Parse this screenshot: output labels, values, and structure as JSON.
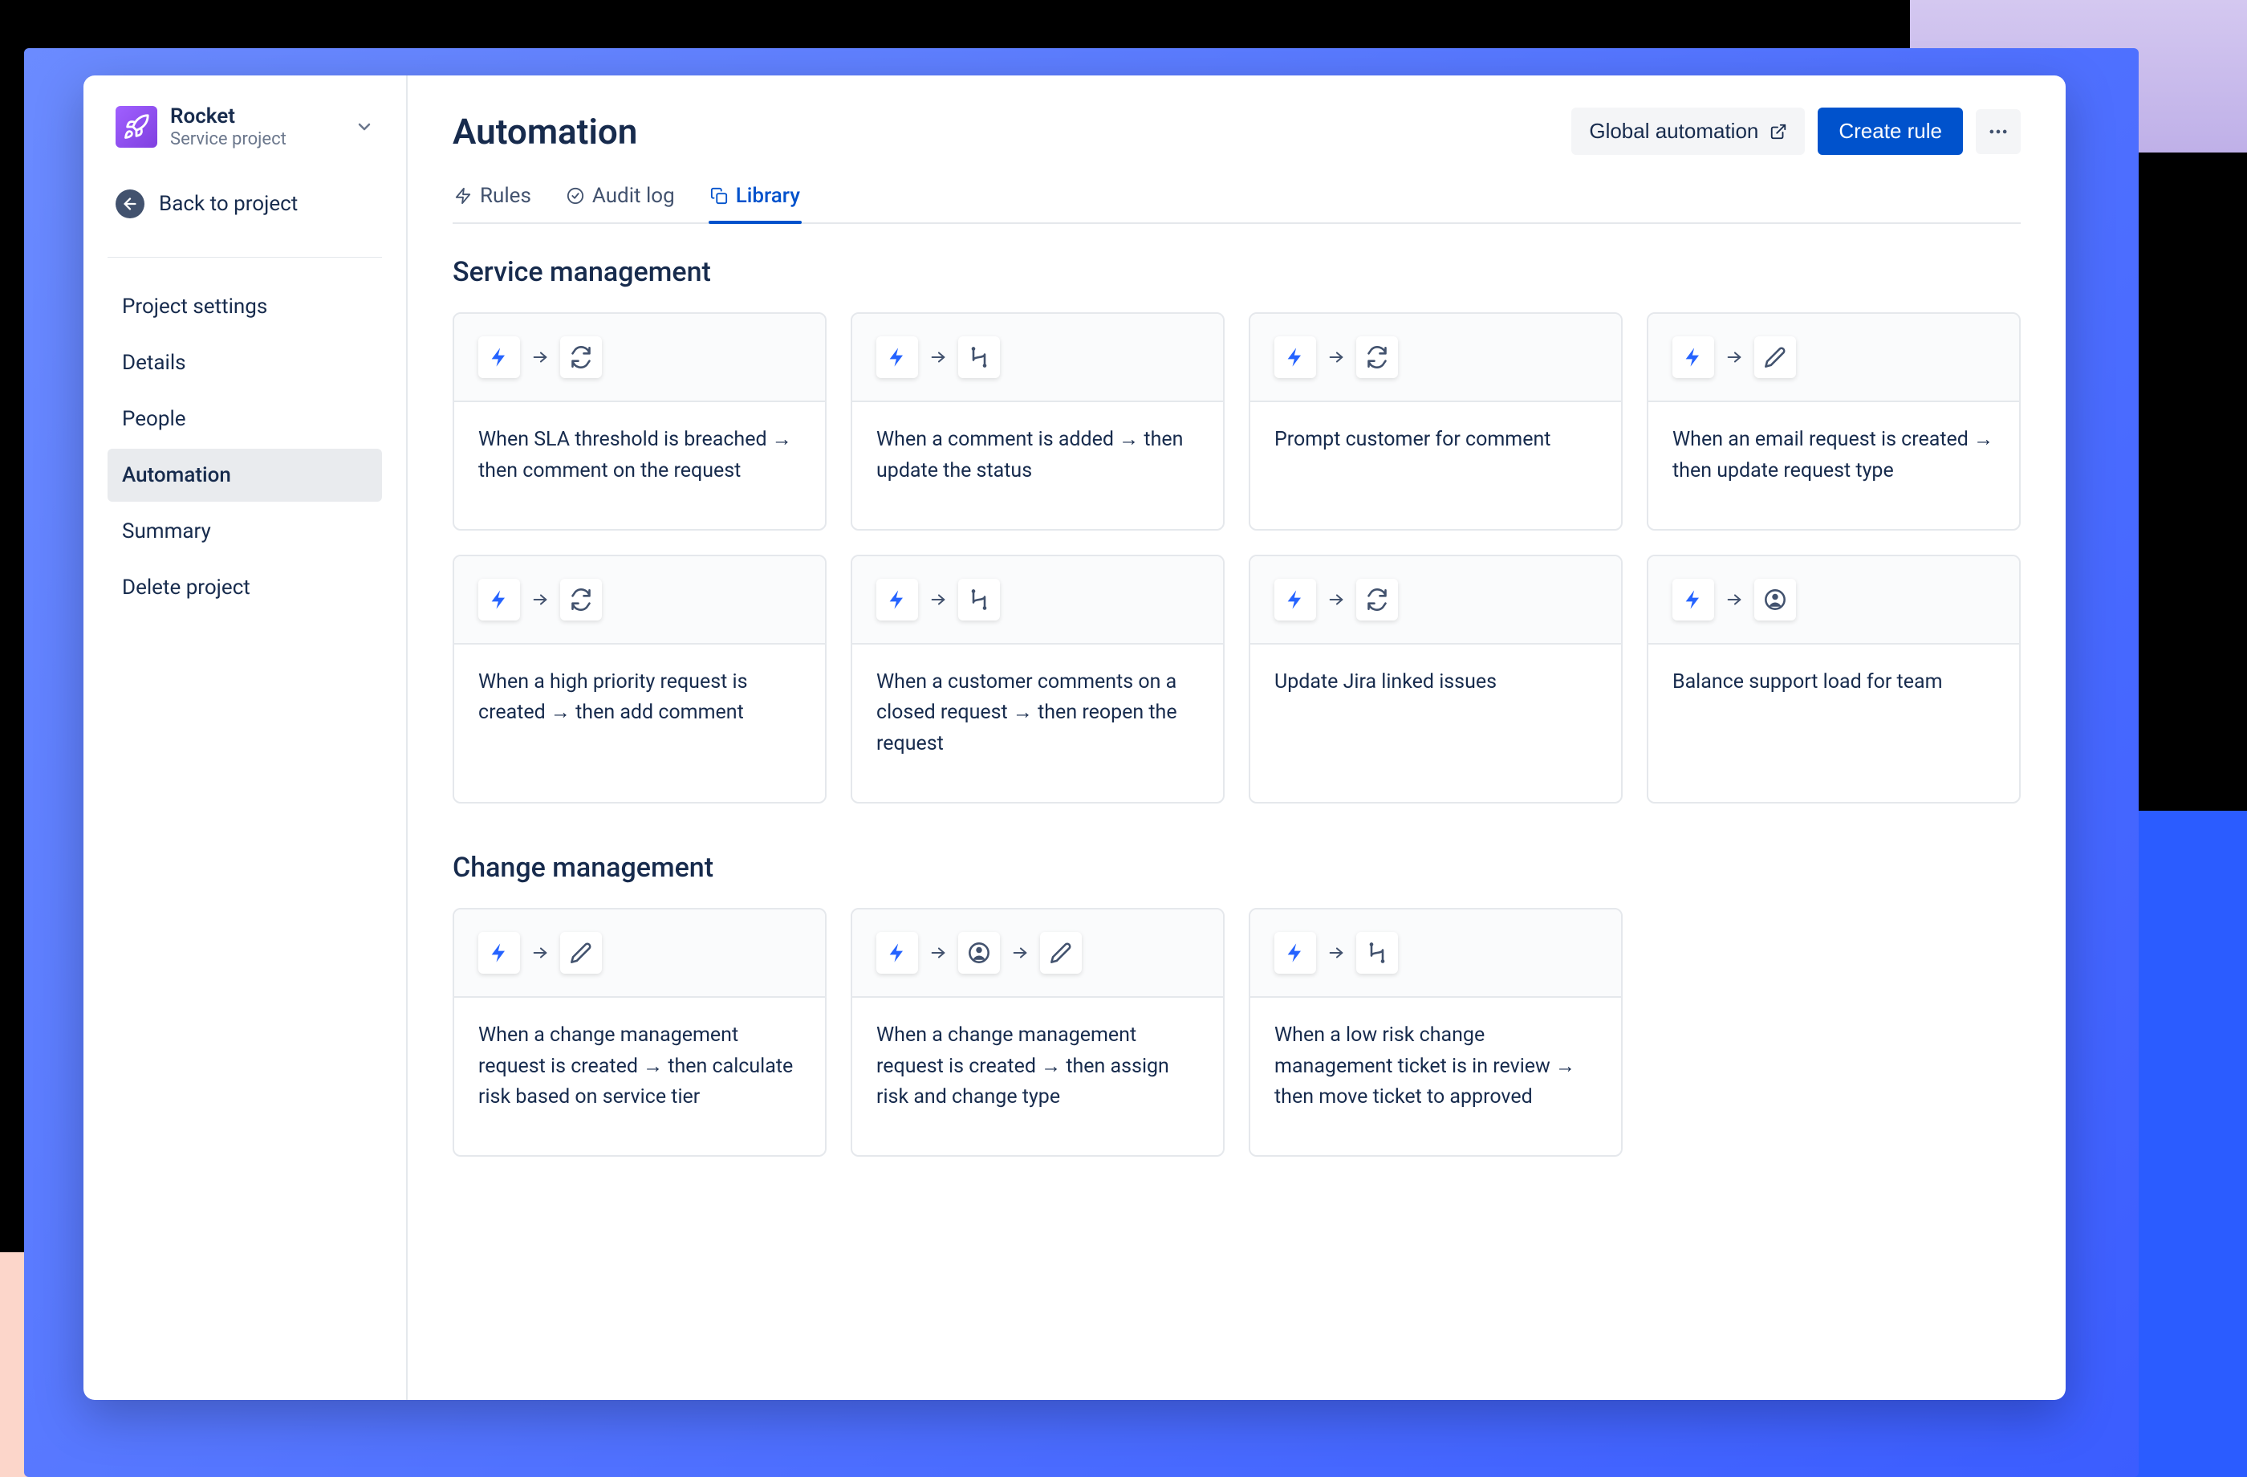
{
  "project": {
    "name": "Rocket",
    "subtitle": "Service project"
  },
  "back_link_label": "Back to project",
  "sidebar_items": [
    {
      "label": "Project settings"
    },
    {
      "label": "Details"
    },
    {
      "label": "People"
    },
    {
      "label": "Automation"
    },
    {
      "label": "Summary"
    },
    {
      "label": "Delete project"
    }
  ],
  "page_title": "Automation",
  "header": {
    "global_automation_label": "Global automation",
    "create_rule_label": "Create rule"
  },
  "tabs": [
    {
      "label": "Rules"
    },
    {
      "label": "Audit log"
    },
    {
      "label": "Library"
    }
  ],
  "sections": [
    {
      "title": "Service management",
      "cards": [
        {
          "icons": [
            "bolt",
            "refresh"
          ],
          "desc": "When SLA threshold is breached → then comment on the request"
        },
        {
          "icons": [
            "bolt",
            "branch"
          ],
          "desc": "When a comment is added → then update the status"
        },
        {
          "icons": [
            "bolt",
            "refresh"
          ],
          "desc": "Prompt customer for comment"
        },
        {
          "icons": [
            "bolt",
            "pencil"
          ],
          "desc": "When an email request is created → then update request type"
        },
        {
          "icons": [
            "bolt",
            "refresh"
          ],
          "desc": "When a high priority request is created → then add comment"
        },
        {
          "icons": [
            "bolt",
            "branch"
          ],
          "desc": "When a customer comments on a closed request → then reopen the request"
        },
        {
          "icons": [
            "bolt",
            "refresh"
          ],
          "desc": "Update Jira linked issues"
        },
        {
          "icons": [
            "bolt",
            "person"
          ],
          "desc": "Balance support load for team"
        }
      ]
    },
    {
      "title": "Change management",
      "cards": [
        {
          "icons": [
            "bolt",
            "pencil"
          ],
          "desc": "When a change management request is created → then calculate risk based on service tier"
        },
        {
          "icons": [
            "bolt",
            "person",
            "pencil"
          ],
          "desc": "When a change management request is created → then assign risk and change type"
        },
        {
          "icons": [
            "bolt",
            "branch"
          ],
          "desc": "When a low risk change management ticket is in review → then move ticket to approved"
        }
      ]
    }
  ],
  "colors": {
    "primary": "#0052cc",
    "bolt": "#2563ff"
  }
}
